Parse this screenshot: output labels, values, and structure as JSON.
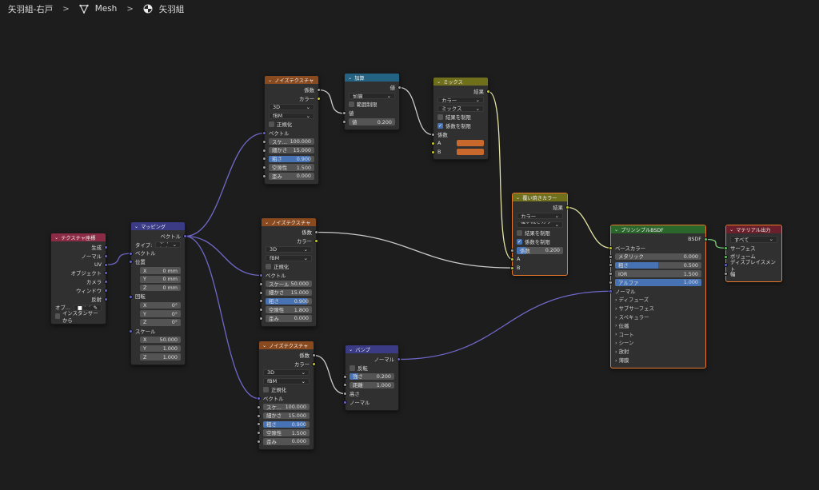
{
  "breadcrumb": {
    "object": "矢羽組-右戸",
    "mesh": "Mesh",
    "material": "矢羽組",
    "icons": [
      "chevron-right-icon",
      "mesh-icon",
      "material-icon"
    ]
  },
  "socket_colors": {
    "float": "#a1a1a1",
    "vector": "#6363c7",
    "color": "#c7c729",
    "shader": "#63c763"
  },
  "nodes": [
    {
      "id": "texcoord",
      "title": "テクスチャ座標",
      "color": "#8c2b45",
      "rows": [
        {
          "t": "out",
          "label": "生成",
          "sock": "vector"
        },
        {
          "t": "out",
          "label": "ノーマル",
          "sock": "vector"
        },
        {
          "t": "out",
          "label": "UV",
          "sock": "vector"
        },
        {
          "t": "out",
          "label": "オブジェクト",
          "sock": "vector"
        },
        {
          "t": "out",
          "label": "カメラ",
          "sock": "vector"
        },
        {
          "t": "out",
          "label": "ウィンドウ",
          "sock": "vector"
        },
        {
          "t": "out",
          "label": "反射",
          "sock": "vector"
        },
        {
          "t": "objpick",
          "label": "オブ...",
          "placeholder": "オブジ"
        },
        {
          "t": "check",
          "label": "インスタンサーから",
          "on": false
        }
      ]
    },
    {
      "id": "mapping",
      "title": "マッピング",
      "color": "#3b3b85",
      "rows": [
        {
          "t": "out",
          "label": "ベクトル",
          "sock": "vector"
        },
        {
          "t": "select",
          "label": "タイプ:",
          "value": "ポイント"
        },
        {
          "t": "in",
          "label": "ベクトル",
          "sock": "vector"
        },
        {
          "t": "in",
          "label": "位置",
          "sock": "vector"
        },
        {
          "t": "field",
          "label": "X",
          "value": "0 mm",
          "ind": true
        },
        {
          "t": "field",
          "label": "Y",
          "value": "0 mm",
          "ind": true
        },
        {
          "t": "field",
          "label": "Z",
          "value": "0 mm",
          "ind": true
        },
        {
          "t": "in",
          "label": "回転",
          "sock": "vector"
        },
        {
          "t": "field",
          "label": "X",
          "value": "0°",
          "ind": true
        },
        {
          "t": "field",
          "label": "Y",
          "value": "0°",
          "ind": true
        },
        {
          "t": "field",
          "label": "Z",
          "value": "0°",
          "ind": true
        },
        {
          "t": "in",
          "label": "スケール",
          "sock": "vector"
        },
        {
          "t": "field",
          "label": "X",
          "value": "50.000",
          "ind": true
        },
        {
          "t": "field",
          "label": "Y",
          "value": "1.000",
          "ind": true
        },
        {
          "t": "field",
          "label": "Z",
          "value": "1.000",
          "ind": true
        }
      ]
    },
    {
      "id": "noise1",
      "title": "ノイズテクスチャ",
      "color": "#8a4a1f",
      "rows": [
        {
          "t": "out",
          "label": "係数",
          "sock": "float"
        },
        {
          "t": "out",
          "label": "カラー",
          "sock": "color"
        },
        {
          "t": "select",
          "value": "3D"
        },
        {
          "t": "select",
          "value": "fBM"
        },
        {
          "t": "check",
          "label": "正規化",
          "on": false
        },
        {
          "t": "in",
          "label": "ベクトル",
          "sock": "vector"
        },
        {
          "t": "field",
          "label": "スケ...",
          "value": "100.000",
          "sock": "float"
        },
        {
          "t": "field",
          "label": "細かさ",
          "value": "15.000",
          "sock": "float"
        },
        {
          "t": "field",
          "label": "粗さ",
          "value": "0.900",
          "sock": "float",
          "fill": 0.9
        },
        {
          "t": "field",
          "label": "空隙性",
          "value": "1.500",
          "sock": "float"
        },
        {
          "t": "field",
          "label": "歪み",
          "value": "0.000",
          "sock": "float"
        }
      ]
    },
    {
      "id": "add",
      "title": "加算",
      "color": "#236283",
      "rows": [
        {
          "t": "out",
          "label": "値",
          "sock": "float"
        },
        {
          "t": "select",
          "value": "加算"
        },
        {
          "t": "check",
          "label": "範囲制限",
          "on": false
        },
        {
          "t": "in",
          "label": "値",
          "sock": "float"
        },
        {
          "t": "field",
          "label": "値",
          "value": "0.200",
          "sock": "float"
        }
      ]
    },
    {
      "id": "mix",
      "title": "ミックス",
      "color": "#6f6f1c",
      "rows": [
        {
          "t": "out",
          "label": "結果",
          "sock": "color"
        },
        {
          "t": "select",
          "value": "カラー"
        },
        {
          "t": "select",
          "value": "ミックス"
        },
        {
          "t": "check",
          "label": "結果を制限",
          "on": false
        },
        {
          "t": "check",
          "label": "係数を制限",
          "on": true
        },
        {
          "t": "in",
          "label": "係数",
          "sock": "float"
        },
        {
          "t": "color",
          "label": "A",
          "sock": "color",
          "value": "#c8682c"
        },
        {
          "t": "color",
          "label": "B",
          "sock": "color",
          "value": "#c8682c"
        }
      ]
    },
    {
      "id": "dodge",
      "title": "覆い焼きカラー",
      "color": "#6f6f1c",
      "selected": true,
      "rows": [
        {
          "t": "out",
          "label": "結果",
          "sock": "color"
        },
        {
          "t": "select",
          "value": "カラー"
        },
        {
          "t": "select",
          "value": "覆い焼きカラー"
        },
        {
          "t": "check",
          "label": "結果を制限",
          "on": false
        },
        {
          "t": "check",
          "label": "係数を制限",
          "on": true
        },
        {
          "t": "field",
          "label": "係数",
          "value": "0.200",
          "sock": "float",
          "fill": 0.2
        },
        {
          "t": "in",
          "label": "A",
          "sock": "color"
        },
        {
          "t": "in",
          "label": "B",
          "sock": "color"
        }
      ]
    },
    {
      "id": "noise2",
      "title": "ノイズテクスチャ",
      "color": "#8a4a1f",
      "rows": [
        {
          "t": "out",
          "label": "係数",
          "sock": "float"
        },
        {
          "t": "out",
          "label": "カラー",
          "sock": "color"
        },
        {
          "t": "select",
          "value": "3D"
        },
        {
          "t": "select",
          "value": "fBM"
        },
        {
          "t": "check",
          "label": "正規化",
          "on": false
        },
        {
          "t": "in",
          "label": "ベクトル",
          "sock": "vector"
        },
        {
          "t": "field",
          "label": "スケール",
          "value": "50.000",
          "sock": "float"
        },
        {
          "t": "field",
          "label": "細かさ",
          "value": "15.000",
          "sock": "float"
        },
        {
          "t": "field",
          "label": "粗さ",
          "value": "0.900",
          "sock": "float",
          "fill": 0.9
        },
        {
          "t": "field",
          "label": "空隙性",
          "value": "1.800",
          "sock": "float"
        },
        {
          "t": "field",
          "label": "歪み",
          "value": "0.000",
          "sock": "float"
        }
      ]
    },
    {
      "id": "noise3",
      "title": "ノイズテクスチャ",
      "color": "#8a4a1f",
      "rows": [
        {
          "t": "out",
          "label": "係数",
          "sock": "float"
        },
        {
          "t": "out",
          "label": "カラー",
          "sock": "color"
        },
        {
          "t": "select",
          "value": "3D"
        },
        {
          "t": "select",
          "value": "fBM"
        },
        {
          "t": "check",
          "label": "正規化",
          "on": false
        },
        {
          "t": "in",
          "label": "ベクトル",
          "sock": "vector"
        },
        {
          "t": "field",
          "label": "スケ...",
          "value": "100.000",
          "sock": "float"
        },
        {
          "t": "field",
          "label": "細かさ",
          "value": "15.000",
          "sock": "float"
        },
        {
          "t": "field",
          "label": "粗さ",
          "value": "0.900",
          "sock": "float",
          "fill": 0.9
        },
        {
          "t": "field",
          "label": "空隙性",
          "value": "1.500",
          "sock": "float"
        },
        {
          "t": "field",
          "label": "歪み",
          "value": "0.000",
          "sock": "float"
        }
      ]
    },
    {
      "id": "bump",
      "title": "バンプ",
      "color": "#3b3b85",
      "rows": [
        {
          "t": "out",
          "label": "ノーマル",
          "sock": "vector"
        },
        {
          "t": "check",
          "label": "反転",
          "on": false
        },
        {
          "t": "field",
          "label": "強さ",
          "value": "0.200",
          "sock": "float",
          "fill": 0.2
        },
        {
          "t": "field",
          "label": "距離",
          "value": "1.000",
          "sock": "float"
        },
        {
          "t": "in",
          "label": "高さ",
          "sock": "float"
        },
        {
          "t": "in",
          "label": "ノーマル",
          "sock": "vector"
        }
      ]
    },
    {
      "id": "bsdf",
      "title": "プリンシプルBSDF",
      "color": "#2b662b",
      "selected": true,
      "rows": [
        {
          "t": "out",
          "label": "BSDF",
          "sock": "shader"
        },
        {
          "t": "in",
          "label": "ベースカラー",
          "sock": "color"
        },
        {
          "t": "field",
          "label": "メタリック",
          "value": "0.000",
          "sock": "float"
        },
        {
          "t": "field",
          "label": "粗さ",
          "value": "0.500",
          "sock": "float",
          "fill": 0.5
        },
        {
          "t": "field",
          "label": "IOR",
          "value": "1.500",
          "sock": "float"
        },
        {
          "t": "field",
          "label": "アルファ",
          "value": "1.000",
          "sock": "float",
          "fill": 1
        },
        {
          "t": "in",
          "label": "ノーマル",
          "sock": "vector"
        },
        {
          "t": "panel",
          "label": "ディフューズ"
        },
        {
          "t": "panel",
          "label": "サブサーフェス"
        },
        {
          "t": "panel",
          "label": "スペキュラー"
        },
        {
          "t": "panel",
          "label": "伝播"
        },
        {
          "t": "panel",
          "label": "コート"
        },
        {
          "t": "panel",
          "label": "シーン"
        },
        {
          "t": "panel",
          "label": "放射"
        },
        {
          "t": "panel",
          "label": "薄膜"
        }
      ]
    },
    {
      "id": "output",
      "title": "マテリアル出力",
      "color": "#6b1f2b",
      "selected": true,
      "rows": [
        {
          "t": "select",
          "value": "すべて"
        },
        {
          "t": "in",
          "label": "サーフェス",
          "sock": "shader"
        },
        {
          "t": "in",
          "label": "ボリューム",
          "sock": "shader"
        },
        {
          "t": "in",
          "label": "ディスプレイスメント",
          "sock": "vector"
        },
        {
          "t": "in",
          "label": "幅",
          "sock": "float"
        }
      ]
    }
  ],
  "links": [
    {
      "from": "texcoord:2",
      "to": "mapping:2"
    },
    {
      "from": "mapping:0",
      "to": "noise1:5"
    },
    {
      "from": "mapping:0",
      "to": "noise2:5"
    },
    {
      "from": "mapping:0",
      "to": "noise3:5"
    },
    {
      "from": "noise1:0",
      "to": "add:3"
    },
    {
      "from": "add:0",
      "to": "mix:5"
    },
    {
      "from": "mix:0",
      "to": "dodge:6"
    },
    {
      "from": "noise2:0",
      "to": "dodge:7"
    },
    {
      "from": "dodge:0",
      "to": "bsdf:1"
    },
    {
      "from": "noise3:0",
      "to": "bump:4"
    },
    {
      "from": "bump:0",
      "to": "bsdf:6"
    },
    {
      "from": "bsdf:0",
      "to": "output:1"
    }
  ]
}
